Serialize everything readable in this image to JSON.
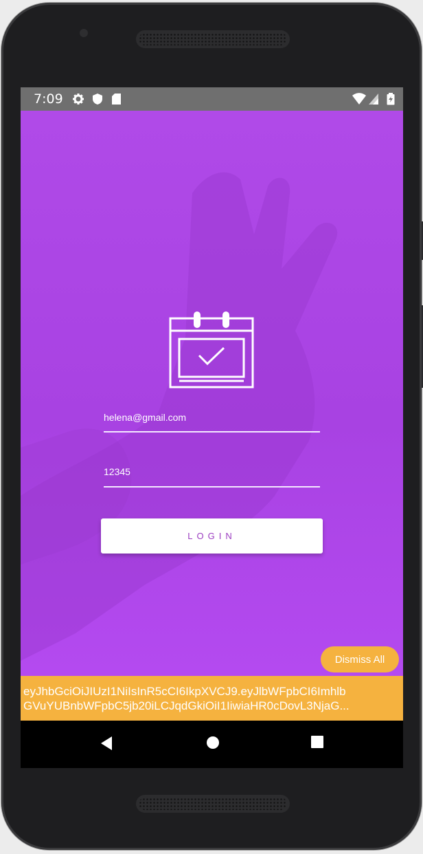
{
  "status_bar": {
    "time": "7:09",
    "left_icons": [
      "gear-icon",
      "shield-icon",
      "sd-card-icon"
    ],
    "right_icons": [
      "wifi-icon",
      "cell-signal-icon",
      "battery-icon"
    ]
  },
  "login_form": {
    "email_value": "helena@gmail.com",
    "password_value": "12345",
    "login_label": "LOGIN"
  },
  "toast": {
    "line1": "eyJhbGciOiJIUzI1NiIsInR5cCI6IkpXVCJ9.eyJlbWFpbCI6Imhlb",
    "line2": "GVuYUBnbWFpbC5jb20iLCJqdGkiOiI1IiwiaHR0cDovL3NjaG..."
  },
  "dismiss_all_label": "Dismiss All",
  "nav_bar": {
    "buttons": [
      "back-icon",
      "home-icon",
      "recents-icon"
    ]
  },
  "colors": {
    "app_background": "#b54af0",
    "accent_yellow": "#f5b23f",
    "button_text": "#9b3cc0"
  }
}
